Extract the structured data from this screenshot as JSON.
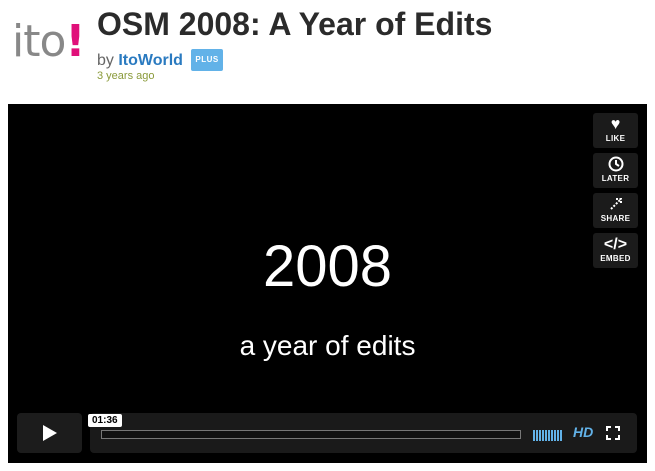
{
  "header": {
    "logo_text": "ito",
    "logo_accent": "!",
    "title": "OSM 2008: A Year of Edits",
    "by_label": "by",
    "author": "ItoWorld",
    "badge": "PLUS",
    "posted": "3 years ago"
  },
  "player": {
    "video_title": "2008",
    "video_subtitle": "a year of edits",
    "timecode": "01:36",
    "progress_fraction": 0,
    "hd_label": "HD",
    "sidebar": [
      {
        "label": "LIKE",
        "icon": "heart-icon"
      },
      {
        "label": "LATER",
        "icon": "clock-icon"
      },
      {
        "label": "SHARE",
        "icon": "share-icon"
      },
      {
        "label": "EMBED",
        "icon": "code-icon"
      }
    ]
  },
  "colors": {
    "brand_pink": "#e0107a",
    "accent_blue": "#62b2e8",
    "posted_green": "#8a9a3a"
  }
}
